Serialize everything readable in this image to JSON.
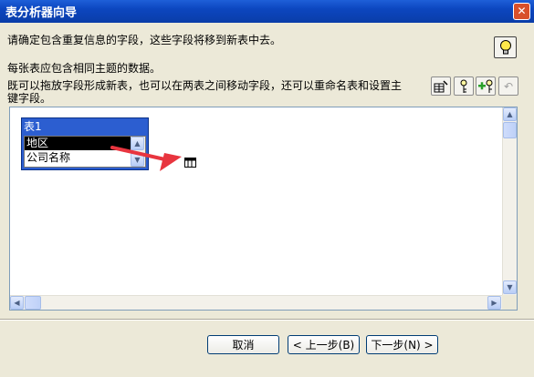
{
  "window": {
    "title": "表分析器向导",
    "close_glyph": "✕"
  },
  "content": {
    "instruction1": "请确定包含重复信息的字段，这些字段将移到新表中去。",
    "instruction2": "每张表应包含相同主题的数据。",
    "instruction3_line1": "既可以拖放字段形成新表，也可以在两表之间移动字段，还可以重命名表和设置主",
    "instruction3_line2": "键字段。"
  },
  "toolbar": {
    "icons": [
      "rename-table-icon",
      "primary-key-icon",
      "add-generated-key-icon",
      "undo-icon"
    ],
    "undo_glyph": "↶"
  },
  "table": {
    "name": "表1",
    "fields": [
      "地区",
      "公司名称"
    ],
    "selected_index": 0
  },
  "scroll_glyphs": {
    "up": "▲",
    "down": "▼",
    "left": "◀",
    "right": "▶"
  },
  "buttons": {
    "cancel": "取消",
    "back": "< 上一步(B)",
    "next": "下一步(N) >"
  },
  "colors": {
    "titlebar": "#0c46bf",
    "table_header": "#2c5ed0",
    "arrow": "#e8353f",
    "dialog_bg": "#ece9d8"
  }
}
